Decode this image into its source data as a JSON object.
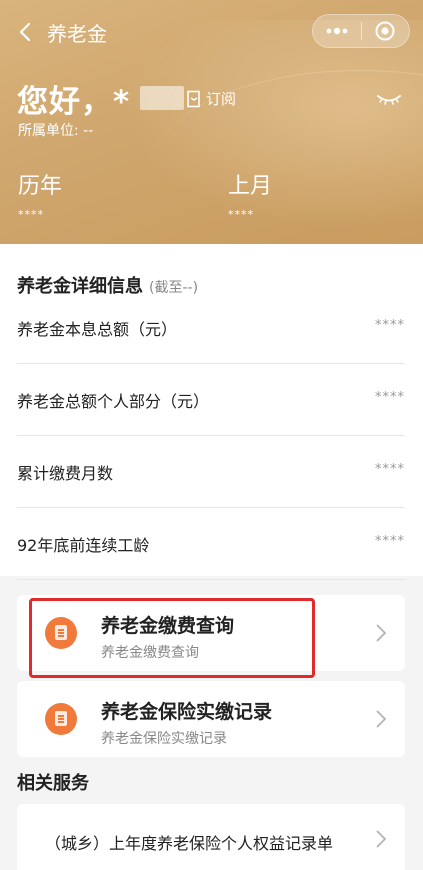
{
  "nav": {
    "title": "养老金",
    "more_icon": "more-dots-icon",
    "close_icon": "target-close-icon"
  },
  "header": {
    "greeting": "您好，*",
    "subscribe_label": "订阅",
    "unit_label": "所属单位: --",
    "stats": [
      {
        "label": "历年",
        "value": "****"
      },
      {
        "label": "上月",
        "value": "****"
      }
    ]
  },
  "detail": {
    "title": "养老金详细信息",
    "subtitle": "(截至--)",
    "rows": [
      {
        "label": "养老金本息总额（元）",
        "value": "****"
      },
      {
        "label": "养老金总额个人部分（元）",
        "value": "****"
      },
      {
        "label": "累计缴费月数",
        "value": "****"
      },
      {
        "label": "92年底前连续工龄",
        "value": "****"
      }
    ]
  },
  "cards": [
    {
      "title": "养老金缴费查询",
      "subtitle": "养老金缴费查询"
    },
    {
      "title": "养老金保险实缴记录",
      "subtitle": "养老金保险实缴记录"
    }
  ],
  "related": {
    "title": "相关服务",
    "items": [
      {
        "label": "（城乡）上年度养老保险个人权益记录单"
      }
    ]
  },
  "colors": {
    "header_gold": "#cfa66d",
    "icon_orange": "#f0793b",
    "highlight_red": "#e12b2b"
  }
}
